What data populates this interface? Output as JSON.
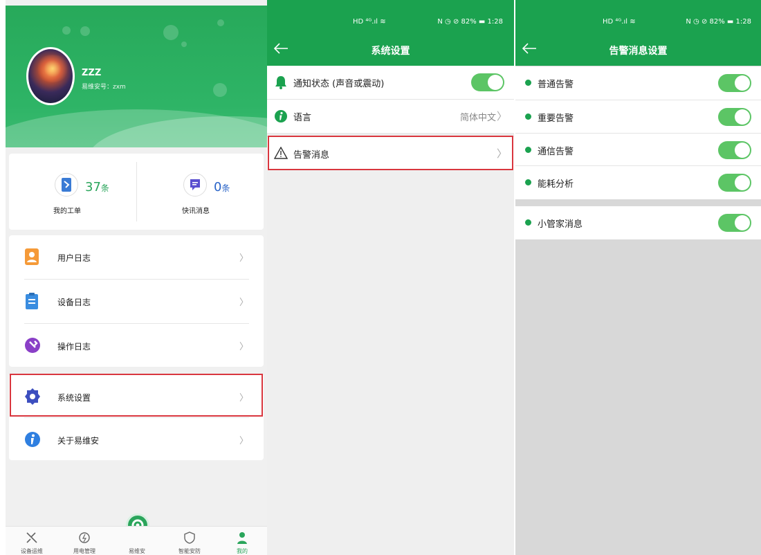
{
  "panel1": {
    "profile": {
      "username": "ZZZ",
      "account": "易维安号：zxm"
    },
    "stats": [
      {
        "count": "37",
        "unit": "条",
        "label": "我的工单",
        "icon": "ticket-icon"
      },
      {
        "count": "0",
        "unit": "条",
        "label": "快讯消息",
        "icon": "message-icon"
      }
    ],
    "menu1": [
      {
        "label": "用户日志",
        "icon": "user-log-icon",
        "chevron": "〉"
      },
      {
        "label": "设备日志",
        "icon": "device-log-icon",
        "chevron": "〉"
      },
      {
        "label": "操作日志",
        "icon": "operation-log-icon",
        "chevron": "〉"
      }
    ],
    "menu2": [
      {
        "label": "系统设置",
        "icon": "gear-icon",
        "chevron": "〉"
      },
      {
        "label": "关于易维安",
        "icon": "info-icon",
        "chevron": "〉"
      }
    ],
    "tabs": [
      {
        "label": "设备运维",
        "icon": "tools-icon"
      },
      {
        "label": "用电管理",
        "icon": "power-icon"
      },
      {
        "label": "易维安",
        "icon": "app-logo-icon"
      },
      {
        "label": "智能安防",
        "icon": "shield-icon"
      },
      {
        "label": "我的",
        "icon": "person-icon",
        "active": true
      }
    ],
    "accent": "#2aa55b"
  },
  "panel2": {
    "status": {
      "left": "HD ⁴ᴳ.ıl ≋",
      "right": "N ◷ ⊘ 82% ▬ 1:28"
    },
    "title": "系统设置",
    "rows": [
      {
        "label": "通知状态 (声音或震动)",
        "icon": "bell-icon",
        "toggle": true
      },
      {
        "label": "语言",
        "icon": "info-icon",
        "value": "简体中文",
        "chevron": "〉"
      },
      {
        "label": "告警消息",
        "icon": "warning-icon",
        "chevron": "〉"
      }
    ]
  },
  "panel3": {
    "status": {
      "left": "HD ⁴ᴳ.ıl ≋",
      "right": "N ◷ ⊘ 82% ▬ 1:28"
    },
    "title": "告警消息设置",
    "rows": [
      {
        "label": "普通告警",
        "toggle": true
      },
      {
        "label": "重要告警",
        "toggle": true
      },
      {
        "label": "通信告警",
        "toggle": true
      },
      {
        "label": "能耗分析",
        "toggle": true
      },
      {
        "label": "小管家消息",
        "toggle": true
      }
    ]
  },
  "colors": {
    "header_green": "#1ba24f",
    "toggle_green": "#5cc565",
    "highlight_red": "#d9363e"
  }
}
